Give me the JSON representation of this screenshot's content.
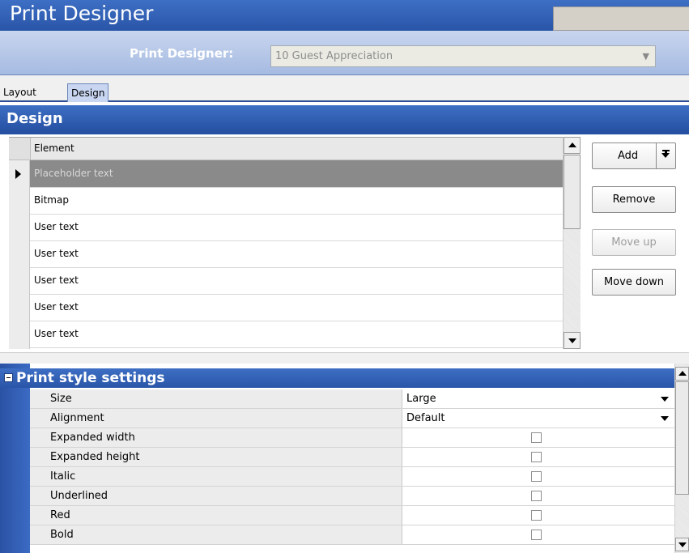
{
  "window": {
    "title": "Print Designer"
  },
  "selector": {
    "label": "Print Designer:",
    "value": "10 Guest Appreciation"
  },
  "tabs": [
    {
      "label": "Layout",
      "active": false
    },
    {
      "label": "Design",
      "active": true
    }
  ],
  "section": {
    "title": "Design"
  },
  "grid": {
    "column_header": "Element",
    "rows": [
      {
        "label": "Placeholder text",
        "selected": true
      },
      {
        "label": "Bitmap",
        "selected": false
      },
      {
        "label": "User text",
        "selected": false
      },
      {
        "label": "User text",
        "selected": false
      },
      {
        "label": "User text",
        "selected": false
      },
      {
        "label": "User text",
        "selected": false
      },
      {
        "label": "User text",
        "selected": false
      }
    ]
  },
  "buttons": {
    "add": "Add",
    "remove": "Remove",
    "move_up": "Move up",
    "move_down": "Move down"
  },
  "properties": {
    "category": "Print style settings",
    "rows": [
      {
        "name": "Size",
        "value": "Large",
        "type": "dropdown"
      },
      {
        "name": "Alignment",
        "value": "Default",
        "type": "dropdown"
      },
      {
        "name": "Expanded width",
        "checked": false,
        "type": "checkbox"
      },
      {
        "name": "Expanded height",
        "checked": false,
        "type": "checkbox"
      },
      {
        "name": "Italic",
        "checked": false,
        "type": "checkbox"
      },
      {
        "name": "Underlined",
        "checked": false,
        "type": "checkbox"
      },
      {
        "name": "Red",
        "checked": false,
        "type": "checkbox"
      },
      {
        "name": "Bold",
        "checked": false,
        "type": "checkbox"
      }
    ]
  },
  "colors": {
    "header_blue": "#2f5fb8",
    "selected_row": "#8a8a8a",
    "selector_bar": "#b4c6e8"
  }
}
